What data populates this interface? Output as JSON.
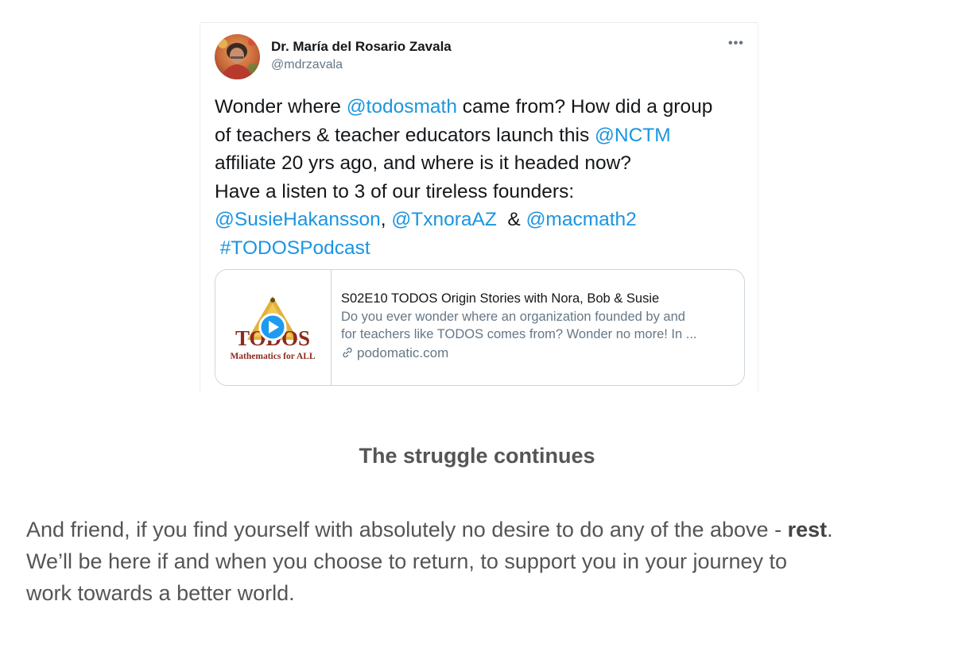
{
  "tweet": {
    "author_name": "Dr. María del Rosario Zavala",
    "author_handle": "@mdrzavala",
    "more_icon": "more-horizontal-icon",
    "lines": {
      "l1_a": "Wonder where ",
      "l1_mention": "@todosmath",
      "l1_b": " came from? How did a group",
      "l2_a": "of teachers & teacher educators launch this ",
      "l2_mention": "@NCTM",
      "l3": "affiliate 20 yrs ago, and where is it headed now?",
      "l4": "Have a listen to 3 of our tireless founders:",
      "l5_mention1": "@SusieHakansson",
      "l5_sep1": ", ",
      "l5_mention2": "@TxnoraAZ",
      "l5_sep2": "  & ",
      "l5_mention3": "@macmath2",
      "l6_hashtag": " #TODOSPodcast"
    },
    "link_card": {
      "thumb_title": "TODOS",
      "thumb_caption": "Mathematics for ALL",
      "title": "S02E10 TODOS Origin Stories with Nora, Bob & Susie",
      "desc_line1": "Do you ever wonder where an organization founded by and",
      "desc_line2": "for teachers like TODOS comes from? Wonder no more! In ...",
      "domain": "podomatic.com",
      "domain_icon": "link-icon",
      "play_icon": "play-icon"
    },
    "colors": {
      "link_blue": "#1b95e0",
      "text_dark": "#14171a",
      "text_gray": "#657786"
    }
  },
  "section": {
    "heading": "The struggle continues"
  },
  "paragraph": {
    "line1_a": "And friend, if you find yourself with absolutely no desire to do any of the above - ",
    "line1_bold": "rest",
    "line1_end": ".",
    "line2": "We’ll be here if and when you choose to return, to support you in your journey to",
    "line3": "work towards a better world."
  }
}
